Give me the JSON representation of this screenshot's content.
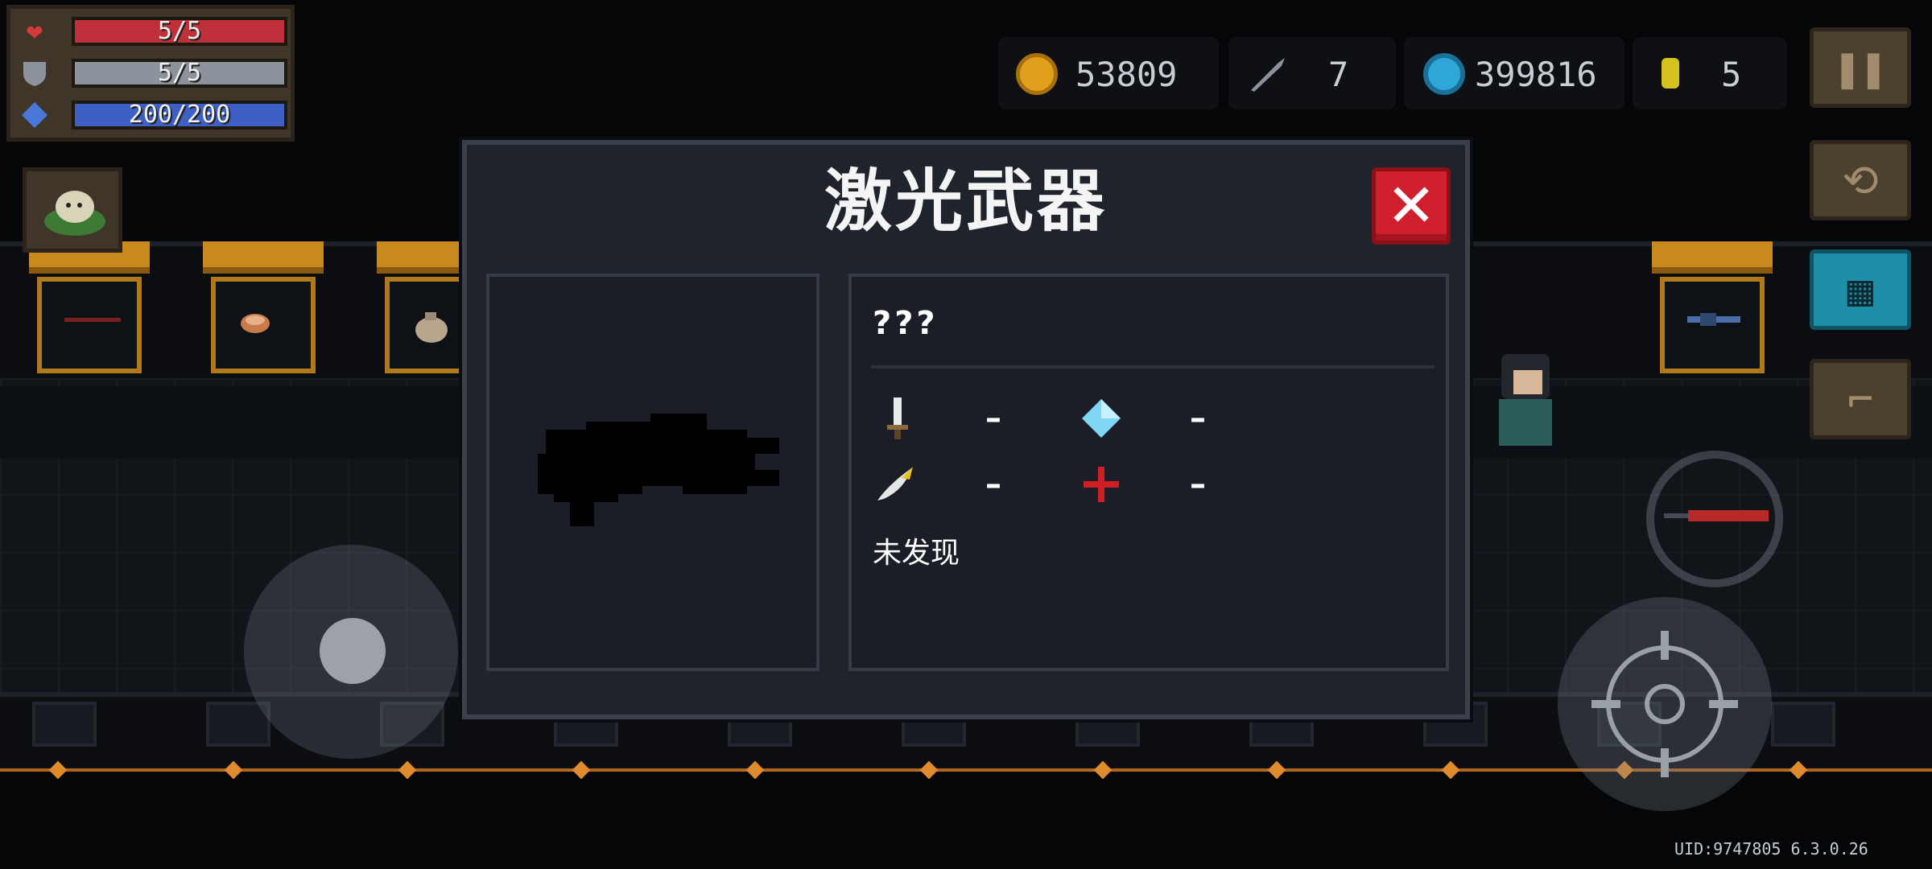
{
  "hud": {
    "hp": {
      "label": "5/5",
      "fraction": 1.0,
      "color": "#c0303a"
    },
    "armor": {
      "label": "5/5",
      "fraction": 1.0,
      "color": "#8c939c"
    },
    "energy": {
      "label": "200/200",
      "fraction": 1.0,
      "color": "#3e5fc4"
    }
  },
  "currency": {
    "gold": {
      "value": "53809",
      "icon": "gold-coin-icon",
      "color": "#e0a01c"
    },
    "fish": {
      "value": "7",
      "icon": "fish-icon"
    },
    "gems": {
      "value": "399816",
      "icon": "gem-icon",
      "color": "#2fa8d8"
    },
    "seeds": {
      "value": "5",
      "icon": "seed-icon",
      "color": "#d6c21c"
    }
  },
  "dialog": {
    "title": "激光武器",
    "close_label": "✕",
    "weapon_name": "???",
    "attributes": {
      "damage": "–",
      "energy_cost": "–",
      "crit": "–",
      "accuracy": "–"
    },
    "status": "未发现"
  },
  "footer": {
    "uid": "UID:9747805 6.3.0.26"
  },
  "side_buttons": [
    "pause-icon",
    "emote-icon",
    "map-icon",
    "exit-icon"
  ]
}
